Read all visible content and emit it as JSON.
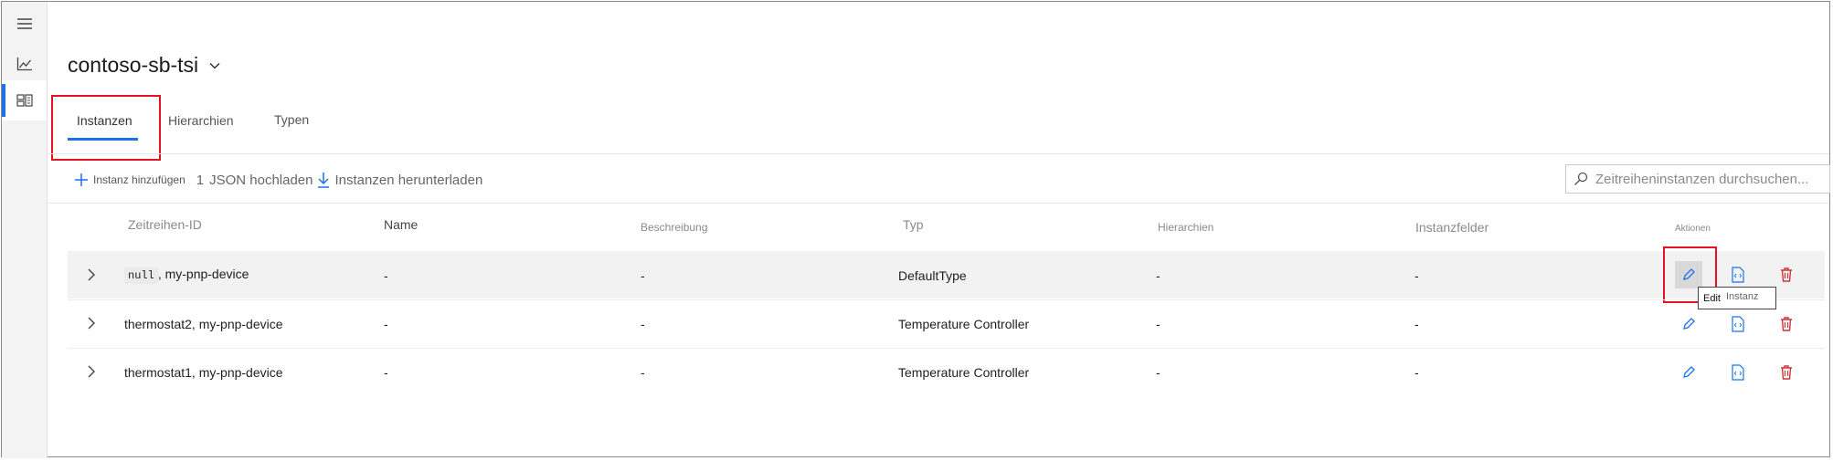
{
  "environment": {
    "name": "contoso-sb-tsi"
  },
  "tabs": [
    {
      "label": "Instanzen",
      "active": true
    },
    {
      "label": "Hierarchien",
      "active": false
    },
    {
      "label": "Typen",
      "active": false
    }
  ],
  "toolbar": {
    "add_label": "Instanz hinzufügen",
    "upload_count": "1",
    "upload_label": "JSON hochladen",
    "download_label": "Instanzen herunterladen"
  },
  "search": {
    "placeholder": "Zeitreiheninstanzen durchsuchen..."
  },
  "table": {
    "headers": [
      "Zeitreihen-ID",
      "Name",
      "Beschreibung",
      "Typ",
      "Hierarchien",
      "Instanzfelder",
      "Aktionen"
    ],
    "rows": [
      {
        "id_code": "null",
        "id_text": ", my-pnp-device",
        "name": "-",
        "description": "-",
        "type": "DefaultType",
        "hierarchies": "-",
        "fields": "-"
      },
      {
        "id_text": "thermostat2, my-pnp-device",
        "name": "-",
        "description": "-",
        "type": "Temperature Controller",
        "hierarchies": "-",
        "fields": "-"
      },
      {
        "id_text": "thermostat1, my-pnp-device",
        "name": "-",
        "description": "-",
        "type": "Temperature Controller",
        "hierarchies": "-",
        "fields": "-"
      }
    ]
  },
  "tooltip": {
    "edit": "Edit",
    "instance": "Instanz"
  },
  "colors": {
    "accent": "#1a73e8",
    "delete": "#d13438",
    "highlight": "#e81123"
  },
  "icons": [
    "menu-icon",
    "chart-icon",
    "model-icon",
    "chevron-down-icon",
    "plus-icon",
    "download-icon",
    "search-icon",
    "chevron-right-icon",
    "pencil-icon",
    "json-doc-icon",
    "trash-icon"
  ]
}
